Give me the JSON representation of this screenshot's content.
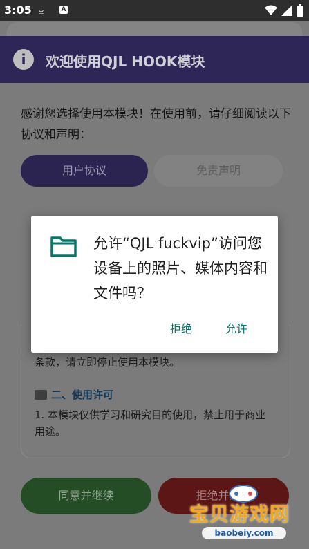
{
  "status_bar": {
    "time": "3:05",
    "download_icon": "download-arrow-icon",
    "notification_badge": "A"
  },
  "app": {
    "header_title": "欢迎使用QJL HOOK模块",
    "intro_text": "感谢您选择使用本模块！在使用前，请仔细阅读以下协议和声明：",
    "tabs": [
      {
        "label": "用户协议",
        "active": true
      },
      {
        "label": "免责声明",
        "active": false
      }
    ],
    "content": {
      "tail_line": "条款，请立即停止使用本模块。",
      "section_heading": "二、使用许可",
      "section_line": "1. 本模块仅供学习和研究目的使用，禁止用于商业用途。"
    },
    "agree_button": "同意并继续",
    "decline_button": "拒绝并退出"
  },
  "dialog": {
    "icon": "folder-icon",
    "message": "允许“QJL fuckvip”访问您设备上的照片、媒体内容和文件吗？",
    "deny_label": "拒绝",
    "allow_label": "允许",
    "accent_color": "#00796b"
  },
  "watermark": {
    "text": "宝贝游戏网",
    "url": "baobeiy.com"
  }
}
